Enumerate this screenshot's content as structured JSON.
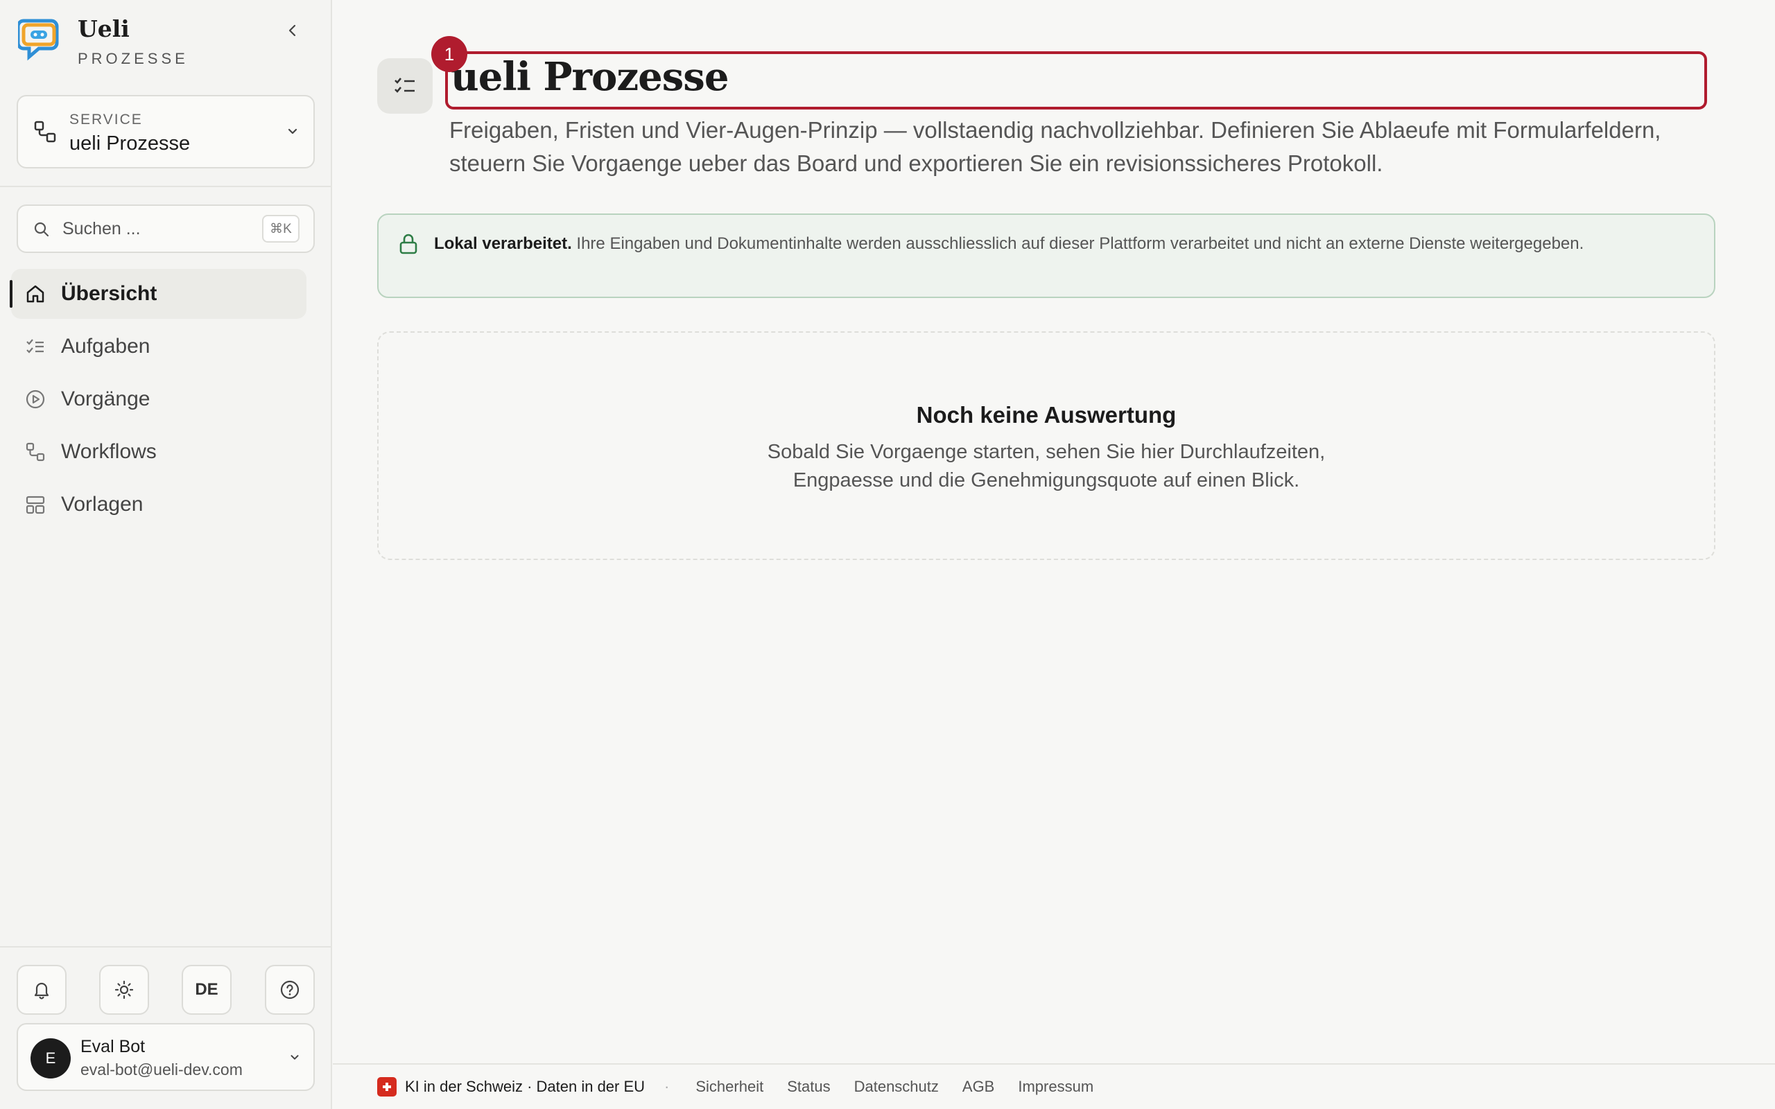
{
  "brand": {
    "name": "Ueli",
    "sub": "PROZESSE"
  },
  "service": {
    "label": "SERVICE",
    "value": "ueli Prozesse"
  },
  "search": {
    "placeholder": "Suchen ...",
    "shortcut": "⌘K"
  },
  "nav": [
    {
      "label": "Übersicht",
      "icon": "home-icon",
      "active": true
    },
    {
      "label": "Aufgaben",
      "icon": "checklist-icon"
    },
    {
      "label": "Vorgänge",
      "icon": "play-circle-icon"
    },
    {
      "label": "Workflows",
      "icon": "workflow-icon"
    },
    {
      "label": "Vorlagen",
      "icon": "template-icon"
    }
  ],
  "tools": {
    "language": "DE"
  },
  "user": {
    "initial": "E",
    "name": "Eval Bot",
    "email": "eval-bot@ueli-dev.com"
  },
  "page": {
    "badge": "1",
    "title": "ueli Prozesse",
    "subtitle": "Freigaben, Fristen und Vier-Augen-Prinzip — vollstaendig nachvollziehbar. Definieren Sie Ablaeufe mit Formularfeldern, steuern Sie Vorgaenge ueber das Board und exportieren Sie ein revisionssicheres Protokoll."
  },
  "notice": {
    "strong": "Lokal verarbeitet.",
    "text": " Ihre Eingaben und Dokumentinhalte werden ausschliesslich auf dieser Plattform verarbeitet und nicht an externe Dienste weitergegeben."
  },
  "empty": {
    "title": "Noch keine Auswertung",
    "text_line1": "Sobald Sie Vorgaenge starten, sehen Sie hier Durchlaufzeiten,",
    "text_line2": "Engpaesse und die Genehmigungsquote auf einen Blick."
  },
  "footer": {
    "main": "KI in der Schweiz · Daten in der EU",
    "dot": "·",
    "links": [
      "Sicherheit",
      "Status",
      "Datenschutz",
      "AGB",
      "Impressum"
    ]
  },
  "colors": {
    "accent_red": "#b01c2e",
    "notice_green": "#2e7d46",
    "swiss_red": "#d52b1e"
  }
}
